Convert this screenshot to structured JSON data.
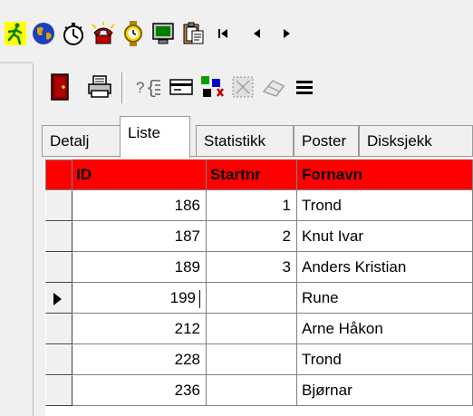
{
  "toolbar_top": {
    "buttons": [
      {
        "name": "runner-icon"
      },
      {
        "name": "globe-icon"
      },
      {
        "name": "stopwatch-icon"
      },
      {
        "name": "phone-alarm-icon"
      },
      {
        "name": "wristwatch-icon"
      },
      {
        "name": "monitor-icon"
      },
      {
        "name": "clipboard-icon"
      },
      {
        "name": "first-record-icon"
      },
      {
        "name": "previous-record-icon"
      },
      {
        "name": "next-record-icon"
      }
    ]
  },
  "toolbar_second": {
    "buttons": [
      {
        "name": "exit-door-icon"
      },
      {
        "name": "print-icon"
      },
      {
        "name": "query-braces-icon"
      },
      {
        "name": "card-icon"
      },
      {
        "name": "relay-team-icon"
      },
      {
        "name": "select-disabled-icon"
      },
      {
        "name": "eraser-disabled-icon"
      },
      {
        "name": "menu-icon"
      }
    ]
  },
  "tabs": [
    "Detalj",
    "Liste",
    "Statistikk",
    "Poster",
    "Disksjekk"
  ],
  "active_tab": "Liste",
  "grid": {
    "columns": [
      "ID",
      "Startnr",
      "Fornavn"
    ],
    "header_color": "#ff0000",
    "rows": [
      {
        "id": "186",
        "startnr": "1",
        "fornavn": "Trond"
      },
      {
        "id": "187",
        "startnr": "2",
        "fornavn": "Knut Ivar"
      },
      {
        "id": "189",
        "startnr": "3",
        "fornavn": "Anders Kristian"
      },
      {
        "id": "199",
        "startnr": "",
        "fornavn": "Rune",
        "current": true
      },
      {
        "id": "212",
        "startnr": "",
        "fornavn": "Arne Håkon"
      },
      {
        "id": "228",
        "startnr": "",
        "fornavn": "Trond"
      },
      {
        "id": "236",
        "startnr": "",
        "fornavn": "Bjørnar"
      }
    ]
  }
}
